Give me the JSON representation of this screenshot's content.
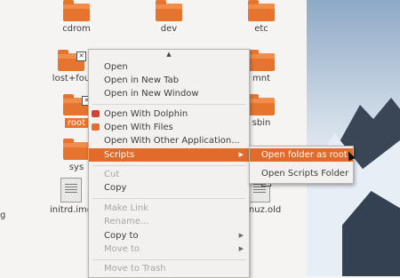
{
  "icons": {
    "cdrom": "cdrom",
    "dev": "dev",
    "etc": "etc",
    "lostfound": "lost+fou",
    "mnt": "mnt",
    "root": "root",
    "sbin": "sbin",
    "sys": "sys",
    "initrd": "initrd.img",
    "vmlinuz": "nlinuz.old",
    "left_edge": "g"
  },
  "context_menu": {
    "items": [
      {
        "label": "Open",
        "enabled": true
      },
      {
        "label": "Open in New Tab",
        "enabled": true
      },
      {
        "label": "Open in New Window",
        "enabled": true
      },
      {
        "label": "Open With Dolphin",
        "enabled": true,
        "icon": "dolphin-icon"
      },
      {
        "label": "Open With Files",
        "enabled": true,
        "icon": "files-icon"
      },
      {
        "label": "Open With Other Application...",
        "enabled": true
      },
      {
        "label": "Scripts",
        "enabled": true,
        "highlighted": true,
        "submenu": true
      },
      {
        "label": "Cut",
        "enabled": false
      },
      {
        "label": "Copy",
        "enabled": true
      },
      {
        "label": "Make Link",
        "enabled": false
      },
      {
        "label": "Rename...",
        "enabled": false
      },
      {
        "label": "Copy to",
        "enabled": true,
        "submenu": true
      },
      {
        "label": "Move to",
        "enabled": false,
        "submenu": true
      },
      {
        "label": "Move to Trash",
        "enabled": false
      }
    ]
  },
  "scripts_submenu": {
    "items": [
      {
        "label": "Open folder as root",
        "highlighted": true
      },
      {
        "label": "Open Scripts Folder"
      }
    ]
  },
  "colors": {
    "accent": "#e06b2b",
    "folder": "#e7742e",
    "menu_bg": "#f2f1f0"
  }
}
